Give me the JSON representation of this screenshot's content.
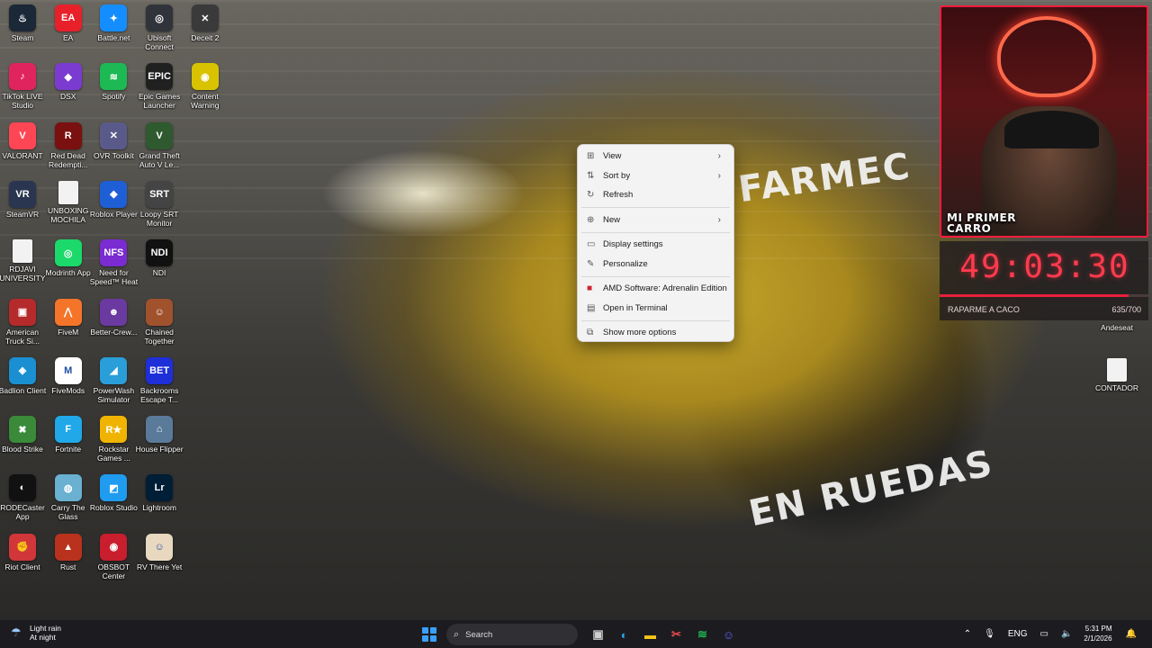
{
  "desktop": {
    "icons": [
      {
        "label": "Steam",
        "icon": "steam-icon",
        "color": "#1b2838",
        "glyph": "♨",
        "col": 0,
        "row": 0
      },
      {
        "label": "EA",
        "icon": "ea-icon",
        "color": "#e8202a",
        "glyph": "EA",
        "col": 1,
        "row": 0
      },
      {
        "label": "Battle.net",
        "icon": "battlenet-icon",
        "color": "#148eff",
        "glyph": "✦",
        "col": 2,
        "row": 0
      },
      {
        "label": "Ubisoft Connect",
        "icon": "ubisoft-icon",
        "color": "#30343a",
        "glyph": "◎",
        "col": 3,
        "row": 0
      },
      {
        "label": "Deceit 2",
        "icon": "deceit-icon",
        "color": "#3a3a3a",
        "glyph": "✕",
        "col": 4,
        "row": 0
      },
      {
        "label": "TikTok LIVE Studio",
        "icon": "tiktok-icon",
        "color": "#e0245e",
        "glyph": "♪",
        "col": 0,
        "row": 1
      },
      {
        "label": "DSX",
        "icon": "dsx-icon",
        "color": "#7b3bd1",
        "glyph": "◆",
        "col": 1,
        "row": 1
      },
      {
        "label": "Spotify",
        "icon": "spotify-icon",
        "color": "#1db954",
        "glyph": "≋",
        "col": 2,
        "row": 1
      },
      {
        "label": "Epic Games Launcher",
        "icon": "epic-icon",
        "color": "#202020",
        "glyph": "EPIC",
        "col": 3,
        "row": 1
      },
      {
        "label": "Content Warning",
        "icon": "content-warning-icon",
        "color": "#d9c200",
        "glyph": "◉",
        "col": 4,
        "row": 1
      },
      {
        "label": "VALORANT",
        "icon": "valorant-icon",
        "color": "#ff4655",
        "glyph": "V",
        "col": 0,
        "row": 2
      },
      {
        "label": "Red Dead Redempti...",
        "icon": "red-dead-icon",
        "color": "#7a1010",
        "glyph": "R",
        "col": 1,
        "row": 2
      },
      {
        "label": "OVR Toolkit",
        "icon": "ovr-toolkit-icon",
        "color": "#5a5a8a",
        "glyph": "✕",
        "col": 2,
        "row": 2
      },
      {
        "label": "Grand Theft Auto V Le...",
        "icon": "gta-icon",
        "color": "#2f5a2f",
        "glyph": "V",
        "col": 3,
        "row": 2
      },
      {
        "label": "SteamVR",
        "icon": "steamvr-icon",
        "color": "#2a3550",
        "glyph": "VR",
        "col": 0,
        "row": 3
      },
      {
        "label": "UNBOXING MOCHILA",
        "icon": "document-icon",
        "color": "#f2f2f2",
        "glyph": "",
        "col": 1,
        "row": 3
      },
      {
        "label": "Roblox Player",
        "icon": "roblox-player-icon",
        "color": "#1f5fd6",
        "glyph": "◆",
        "col": 2,
        "row": 3
      },
      {
        "label": "Loopy SRT Monitor",
        "icon": "srt-monitor-icon",
        "color": "#444",
        "glyph": "SRT",
        "col": 3,
        "row": 3
      },
      {
        "label": "RDJAVI UNIVERSITY",
        "icon": "document-icon",
        "color": "#f2f2f2",
        "glyph": "",
        "col": 0,
        "row": 4
      },
      {
        "label": "Modrinth App",
        "icon": "modrinth-icon",
        "color": "#1bd96a",
        "glyph": "◎",
        "col": 1,
        "row": 4
      },
      {
        "label": "Need for Speed™ Heat",
        "icon": "nfs-icon",
        "color": "#7a2bd1",
        "glyph": "NFS",
        "col": 2,
        "row": 4
      },
      {
        "label": "NDI",
        "icon": "ndi-icon",
        "color": "#111",
        "glyph": "NDI",
        "col": 3,
        "row": 4
      },
      {
        "label": "American Truck Si...",
        "icon": "truck-icon",
        "color": "#b52a2a",
        "glyph": "▣",
        "col": 0,
        "row": 5
      },
      {
        "label": "FiveM",
        "icon": "fivem-icon",
        "color": "#f4742a",
        "glyph": "⋀",
        "col": 1,
        "row": 5
      },
      {
        "label": "Better-Crew...",
        "icon": "better-crew-icon",
        "color": "#6a3aa0",
        "glyph": "☻",
        "col": 2,
        "row": 5
      },
      {
        "label": "Chained Together",
        "icon": "chained-icon",
        "color": "#a0522d",
        "glyph": "☺",
        "col": 3,
        "row": 5
      },
      {
        "label": "Badlion Client",
        "icon": "badlion-icon",
        "color": "#1a8fd1",
        "glyph": "◈",
        "col": 0,
        "row": 6
      },
      {
        "label": "FiveMods",
        "icon": "fivemods-icon",
        "color": "#ffffff",
        "glyph": "M",
        "col": 1,
        "row": 6
      },
      {
        "label": "PowerWash Simulator",
        "icon": "powerwash-icon",
        "color": "#2a9ed8",
        "glyph": "◢",
        "col": 2,
        "row": 6
      },
      {
        "label": "Backrooms Escape T...",
        "icon": "backrooms-icon",
        "color": "#1e2fd8",
        "glyph": "BET",
        "col": 3,
        "row": 6
      },
      {
        "label": "Blood Strike",
        "icon": "blood-strike-icon",
        "color": "#3a8a3a",
        "glyph": "✖",
        "col": 0,
        "row": 7
      },
      {
        "label": "Fortnite",
        "icon": "fortnite-icon",
        "color": "#20a8e8",
        "glyph": "F",
        "col": 1,
        "row": 7
      },
      {
        "label": "Rockstar Games ...",
        "icon": "rockstar-icon",
        "color": "#f0b400",
        "glyph": "R★",
        "col": 2,
        "row": 7
      },
      {
        "label": "House Flipper",
        "icon": "house-flipper-icon",
        "color": "#5a7a9a",
        "glyph": "⌂",
        "col": 3,
        "row": 7
      },
      {
        "label": "RODECaster App",
        "icon": "rodecaster-icon",
        "color": "#111",
        "glyph": "◐",
        "col": 0,
        "row": 8
      },
      {
        "label": "Carry The Glass",
        "icon": "carry-glass-icon",
        "color": "#6ab0d0",
        "glyph": "◍",
        "col": 1,
        "row": 8
      },
      {
        "label": "Roblox Studio",
        "icon": "roblox-studio-icon",
        "color": "#1f9cf0",
        "glyph": "◩",
        "col": 2,
        "row": 8
      },
      {
        "label": "Lightroom",
        "icon": "lightroom-icon",
        "color": "#001e36",
        "glyph": "Lr",
        "col": 3,
        "row": 8
      },
      {
        "label": "Riot Client",
        "icon": "riot-client-icon",
        "color": "#d13639",
        "glyph": "✊",
        "col": 0,
        "row": 9
      },
      {
        "label": "Rust",
        "icon": "rust-icon",
        "color": "#b8321e",
        "glyph": "▲",
        "col": 1,
        "row": 9
      },
      {
        "label": "OBSBOT Center",
        "icon": "obsbot-icon",
        "color": "#c81e2d",
        "glyph": "◉",
        "col": 2,
        "row": 9
      },
      {
        "label": "RV There Yet",
        "icon": "rv-there-yet-icon",
        "color": "#e8d8c0",
        "glyph": "☺",
        "col": 3,
        "row": 9
      }
    ],
    "right_icons": [
      {
        "label": "Andeseat",
        "icon": "app-icon"
      },
      {
        "label": "CONTADOR",
        "icon": "document-icon"
      }
    ]
  },
  "context_menu": {
    "items": [
      {
        "label": "View",
        "icon": "grid-icon",
        "glyph": "⊞",
        "submenu": true
      },
      {
        "label": "Sort by",
        "icon": "sort-icon",
        "glyph": "⇅",
        "submenu": true
      },
      {
        "label": "Refresh",
        "icon": "refresh-icon",
        "glyph": "↻",
        "submenu": false
      },
      {
        "sep": true
      },
      {
        "label": "New",
        "icon": "plus-circle-icon",
        "glyph": "⊕",
        "submenu": true
      },
      {
        "sep": true
      },
      {
        "label": "Display settings",
        "icon": "display-icon",
        "glyph": "▭",
        "submenu": false
      },
      {
        "label": "Personalize",
        "icon": "brush-icon",
        "glyph": "✎",
        "submenu": false
      },
      {
        "sep": true
      },
      {
        "label": "AMD Software: Adrenalin Edition",
        "icon": "amd-icon",
        "glyph": "■",
        "submenu": false
      },
      {
        "label": "Open in Terminal",
        "icon": "terminal-icon",
        "glyph": "▤",
        "submenu": false
      },
      {
        "sep": true
      },
      {
        "label": "Show more options",
        "icon": "more-options-icon",
        "glyph": "⧉",
        "submenu": false
      }
    ]
  },
  "wallpaper": {
    "decal_top": "FARMEC",
    "decal_bottom": "EN RUEDAS"
  },
  "overlay": {
    "cam_title_line1": "MI PRIMER",
    "cam_title_line2": "CARRO",
    "timer": "49:03:30",
    "goal_label": "RAPARME A CACO",
    "goal_count": "635/700",
    "goal_progress": 0.907
  },
  "taskbar": {
    "weather_line1": "Light rain",
    "weather_line2": "At night",
    "search_placeholder": "Search",
    "apps": [
      {
        "icon": "task-view-icon",
        "glyph": "▣",
        "color": "#cfcfcf"
      },
      {
        "icon": "edge-icon",
        "glyph": "◐",
        "color": "#2aa6e8"
      },
      {
        "icon": "file-explorer-icon",
        "glyph": "▬",
        "color": "#f5c518"
      },
      {
        "icon": "snipping-tool-icon",
        "glyph": "✂",
        "color": "#e84a4a"
      },
      {
        "icon": "spotify-icon",
        "glyph": "≋",
        "color": "#1db954"
      },
      {
        "icon": "discord-icon",
        "glyph": "☺",
        "color": "#5865f2"
      }
    ],
    "tray": {
      "language": "ENG",
      "time": "5:31 PM",
      "date": "2/1/2026"
    }
  }
}
